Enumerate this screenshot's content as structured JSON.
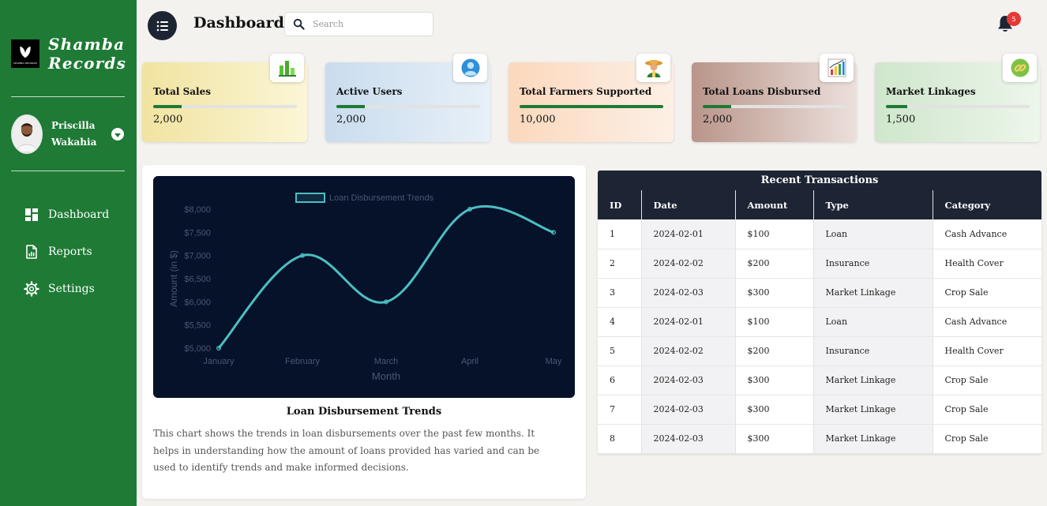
{
  "brand": {
    "line1": "Shamba",
    "line2": "Records",
    "logo_text": "SHAMBA RECORDS"
  },
  "user": {
    "first_name": "Priscilla",
    "last_name": "Wakahia"
  },
  "nav": [
    {
      "label": "Dashboard",
      "icon": "dashboard-icon"
    },
    {
      "label": "Reports",
      "icon": "report-icon"
    },
    {
      "label": "Settings",
      "icon": "gear-icon"
    }
  ],
  "header": {
    "title": "Dashboard",
    "search_placeholder": "Search",
    "notifications": "5"
  },
  "cards": [
    {
      "title": "Total Sales",
      "value": "2,000",
      "progress": 0.2,
      "icon": "bar-chart-icon",
      "gradient": [
        "#f1e3a1",
        "#fbf6d6"
      ]
    },
    {
      "title": "Active Users",
      "value": "2,000",
      "progress": 0.2,
      "icon": "user-icon",
      "gradient": [
        "#c9dcee",
        "#e8f0f8"
      ]
    },
    {
      "title": "Total Farmers Supported",
      "value": "10,000",
      "progress": 1.0,
      "icon": "farmer-icon",
      "gradient": [
        "#fbd8bd",
        "#fdf0e5"
      ]
    },
    {
      "title": "Total Loans Disbursed",
      "value": "2,000",
      "progress": 0.2,
      "icon": "growth-chart-icon",
      "gradient": [
        "#b9958a",
        "#ece0dc"
      ]
    },
    {
      "title": "Market Linkages",
      "value": "1,500",
      "progress": 0.15,
      "icon": "link-icon",
      "gradient": [
        "#cfe6cc",
        "#edf6eb"
      ]
    }
  ],
  "chart": {
    "caption": "Loan Disbursement Trends",
    "description": "This chart shows the trends in loan disbursements over the past few months. It helps in understanding how the amount of loans provided has varied and can be used to identify trends and make informed decisions."
  },
  "chart_data": {
    "type": "line",
    "title": "",
    "legend": "Loan Disbursement Trends",
    "legend_position": "top",
    "x": [
      "January",
      "February",
      "March",
      "April",
      "May"
    ],
    "series": [
      {
        "name": "Loan Disbursement Trends",
        "values": [
          5000,
          7000,
          6000,
          8000,
          7500
        ]
      }
    ],
    "xlabel": "Month",
    "ylabel": "Amount (in $)",
    "ylim": [
      5000,
      8000
    ],
    "yticks": [
      "$5,000",
      "$5,500",
      "$6,000",
      "$6,500",
      "$7,000",
      "$7,500",
      "$8,000"
    ],
    "yticks_values": [
      5000,
      5500,
      6000,
      6500,
      7000,
      7500,
      8000
    ],
    "grid": false,
    "line_color": "#4bbfc0",
    "background": "#06112a"
  },
  "transactions": {
    "title": "Recent Transactions",
    "columns": [
      "ID",
      "Date",
      "Amount",
      "Type",
      "Category"
    ],
    "rows": [
      [
        "1",
        "2024-02-01",
        "$100",
        "Loan",
        "Cash Advance"
      ],
      [
        "2",
        "2024-02-02",
        "$200",
        "Insurance",
        "Health Cover"
      ],
      [
        "3",
        "2024-02-03",
        "$300",
        "Market Linkage",
        "Crop Sale"
      ],
      [
        "4",
        "2024-02-01",
        "$100",
        "Loan",
        "Cash Advance"
      ],
      [
        "5",
        "2024-02-02",
        "$200",
        "Insurance",
        "Health Cover"
      ],
      [
        "6",
        "2024-02-03",
        "$300",
        "Market Linkage",
        "Crop Sale"
      ],
      [
        "7",
        "2024-02-03",
        "$300",
        "Market Linkage",
        "Crop Sale"
      ],
      [
        "8",
        "2024-02-03",
        "$300",
        "Market Linkage",
        "Crop Sale"
      ]
    ]
  }
}
